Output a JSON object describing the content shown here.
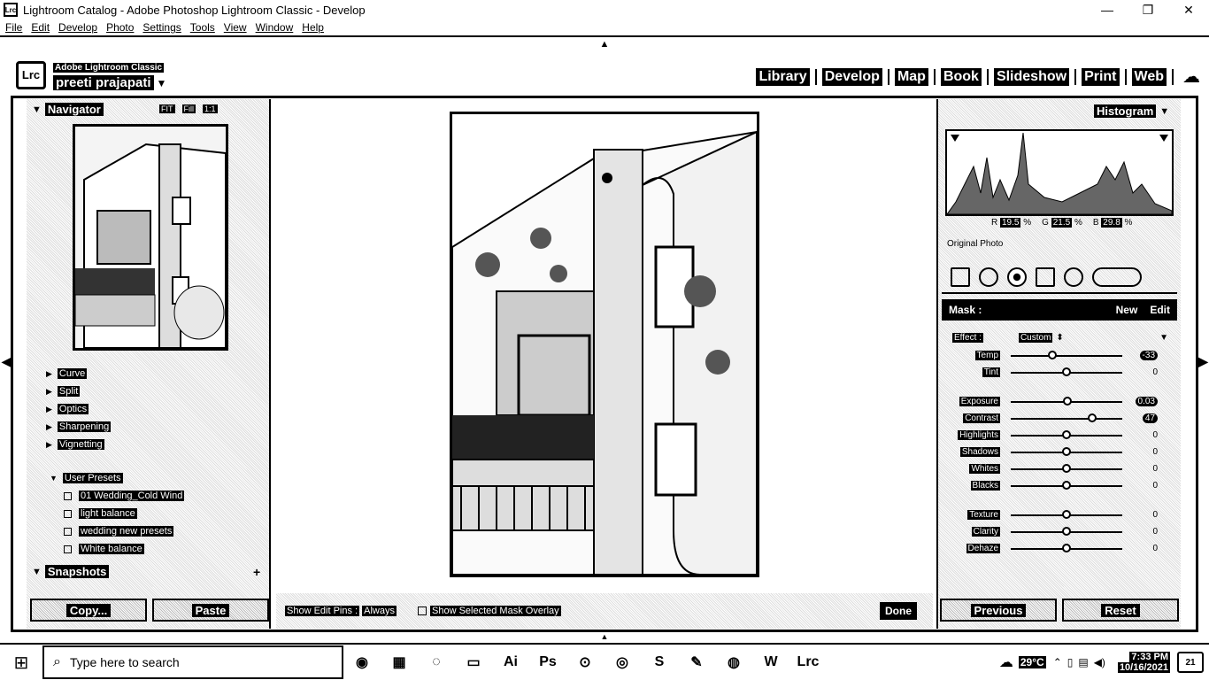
{
  "window": {
    "app_icon": "Lrc",
    "title": "Lightroom Catalog - Adobe Photoshop Lightroom Classic - Develop",
    "minimize": "—",
    "maximize": "❐",
    "close": "✕"
  },
  "menu": [
    "File",
    "Edit",
    "Develop",
    "Photo",
    "Settings",
    "Tools",
    "View",
    "Window",
    "Help"
  ],
  "identity": {
    "logo": "Lrc",
    "product": "Adobe Lightroom Classic",
    "user": "preeti prajapati"
  },
  "modules": [
    "Library",
    "Develop",
    "Map",
    "Book",
    "Slideshow",
    "Print",
    "Web"
  ],
  "left_panel": {
    "navigator": {
      "title": "Navigator",
      "fit": "FIT",
      "fill": "Fill",
      "one": "1:1"
    },
    "develop_items": [
      "Curve",
      "Split",
      "Optics",
      "Sharpening",
      "Vignetting"
    ],
    "user_presets": {
      "title": "User Presets",
      "items": [
        "01 Wedding_Cold Wind",
        "light balance",
        "wedding new presets",
        "White balance"
      ]
    },
    "snapshots": {
      "title": "Snapshots"
    },
    "copy_label": "Copy...",
    "paste_label": "Paste"
  },
  "toolbar": {
    "show_pins_label": "Show Edit Pins :",
    "show_pins_value": "Always",
    "overlay_label": "Show Selected Mask Overlay",
    "done_label": "Done"
  },
  "right_panel": {
    "histogram": {
      "title": "Histogram",
      "r": "19.5",
      "g": "21.5",
      "b": "29.8"
    },
    "original_photo": "Original Photo",
    "mask": {
      "label": "Mask :",
      "new": "New",
      "edit": "Edit"
    },
    "effect": {
      "label": "Effect :",
      "value": "Custom"
    },
    "sliders": [
      {
        "name": "Temp",
        "value": "-33",
        "highlight": true,
        "pos": 0.37
      },
      {
        "name": "Tint",
        "value": "0",
        "highlight": false,
        "pos": 0.5
      },
      {
        "name": "Exposure",
        "value": "0.03",
        "highlight": true,
        "pos": 0.51
      },
      {
        "name": "Contrast",
        "value": "47",
        "highlight": true,
        "pos": 0.73
      },
      {
        "name": "Highlights",
        "value": "0",
        "highlight": false,
        "pos": 0.5
      },
      {
        "name": "Shadows",
        "value": "0",
        "highlight": false,
        "pos": 0.5
      },
      {
        "name": "Whites",
        "value": "0",
        "highlight": false,
        "pos": 0.5
      },
      {
        "name": "Blacks",
        "value": "0",
        "highlight": false,
        "pos": 0.5
      },
      {
        "name": "Texture",
        "value": "0",
        "highlight": false,
        "pos": 0.5
      },
      {
        "name": "Clarity",
        "value": "0",
        "highlight": false,
        "pos": 0.5
      },
      {
        "name": "Dehaze",
        "value": "0",
        "highlight": false,
        "pos": 0.5
      }
    ],
    "previous_label": "Previous",
    "reset_label": "Reset"
  },
  "taskbar": {
    "search_placeholder": "Type here to search",
    "temperature": "29°C",
    "time": "7:33 PM",
    "date": "10/16/2021",
    "notifications": "21"
  }
}
